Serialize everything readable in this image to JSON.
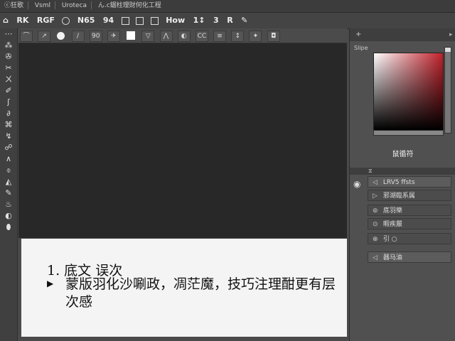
{
  "menubar": {
    "items": [
      "ⓒ狂歌",
      "Vsml",
      "Uroteca",
      "ん.c鋸柱理財何化工程"
    ]
  },
  "options_bar": {
    "items": [
      "RK",
      "RGF",
      "N65",
      "94",
      "How",
      "1↕",
      "3",
      "R"
    ]
  },
  "tool_options": {
    "items": [
      "⌒",
      "↗",
      "/",
      "90",
      "✈",
      "▽",
      "⋀",
      "◐",
      "CC",
      "≡",
      "↕",
      "✦",
      "◘"
    ]
  },
  "toolbar": {
    "tools": [
      "⁂",
      "✇",
      "✂",
      "ㄨ",
      "✐",
      "ʃ",
      "∂",
      "⌘",
      "↯",
      "☍",
      "∧",
      "⌽",
      "◭",
      "✎",
      "♨",
      "◐",
      "⬮"
    ]
  },
  "document_text": {
    "line1": "1. 底文 误次",
    "bullet": "▶",
    "line2": "蒙版羽化沙唰政，凋茫魔，技巧注理酣更有层次感"
  },
  "color_panel": {
    "header_left": "+",
    "header_right": "▸",
    "slider_label": "Slipe",
    "footer_label": "鼠循符",
    "colors": {
      "picker_hue": "#c0202a",
      "background": "#505050"
    }
  },
  "properties_panel": {
    "header": "⧖",
    "items": [
      {
        "icon": "◁",
        "label": "LRV5 ffsts",
        "selected": true
      },
      {
        "icon": "▷",
        "label": "邪湖臨系属",
        "selected": false
      },
      {
        "icon": "⊚",
        "label": "底羽樂",
        "selected": false
      },
      {
        "icon": "⊙",
        "label": "暇疾嚴",
        "selected": false
      },
      {
        "icon": "⊗",
        "label": "引 ○",
        "selected": false
      },
      {
        "icon": "◁",
        "label": "器马油",
        "selected": false
      }
    ]
  }
}
